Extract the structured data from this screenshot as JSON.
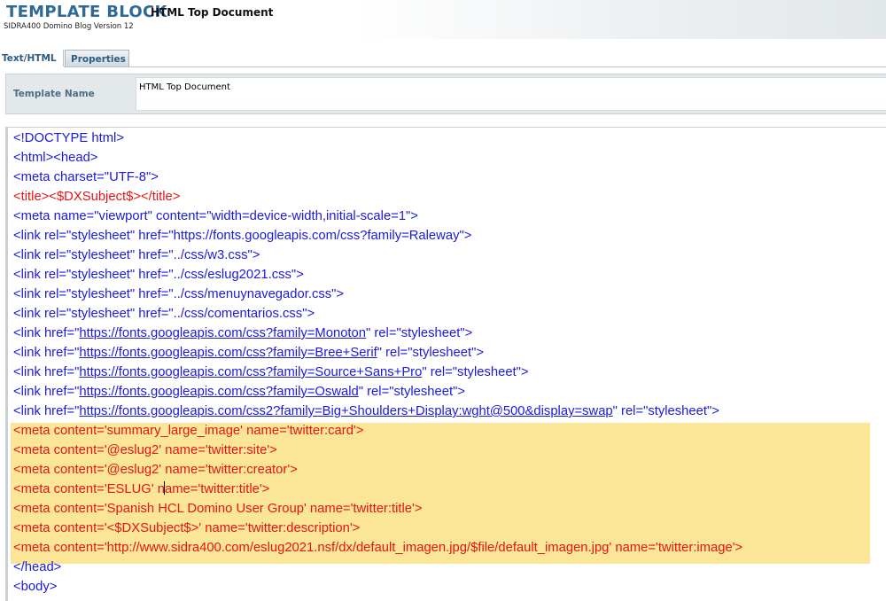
{
  "header": {
    "title": "TEMPLATE BLOCK",
    "subtitle": "HTML Top Document",
    "app_version": "SIDRA400 Domino Blog Version 12"
  },
  "tabs": [
    {
      "label": "Text/HTML",
      "active": true
    },
    {
      "label": "Properties",
      "active": false
    }
  ],
  "template_name": {
    "label": "Template Name",
    "value": "HTML Top Document"
  },
  "colors": {
    "title_blue": "#2d6a96",
    "code_blue": "#1a1adc",
    "code_red": "#e61414",
    "highlight": "#fbe597"
  },
  "code_lines": [
    {
      "color": "blue",
      "parts": [
        {
          "t": "<!DOCTYPE html>"
        }
      ]
    },
    {
      "color": "blue",
      "parts": [
        {
          "t": "<html><head>"
        }
      ]
    },
    {
      "color": "blue",
      "parts": [
        {
          "t": "<meta charset=\"UTF-8\">"
        }
      ]
    },
    {
      "color": "red",
      "parts": [
        {
          "t": "<title><$DXSubject$></title>"
        }
      ]
    },
    {
      "color": "blue",
      "parts": [
        {
          "t": "<meta name=\"viewport\" content=\"width=device-width,initial-scale=1\">"
        }
      ]
    },
    {
      "color": "blue",
      "parts": [
        {
          "t": "<link rel=\"stylesheet\" href=\"https://fonts.googleapis.com/css?family=Raleway\">"
        }
      ]
    },
    {
      "color": "blue",
      "parts": [
        {
          "t": "<link rel=\"stylesheet\" href=\"../css/w3.css\">"
        }
      ]
    },
    {
      "color": "blue",
      "parts": [
        {
          "t": "<link rel=\"stylesheet\" href=\"../css/eslug2021.css\">"
        }
      ]
    },
    {
      "color": "blue",
      "parts": [
        {
          "t": "<link rel=\"stylesheet\" href=\"../css/menuynavegador.css\">"
        }
      ]
    },
    {
      "color": "blue",
      "parts": [
        {
          "t": "<link rel=\"stylesheet\" href=\"../css/comentarios.css\">"
        }
      ]
    },
    {
      "color": "blue",
      "parts": [
        {
          "t": "<link href=\""
        },
        {
          "t": "https://fonts.googleapis.com/css?family=Monoton",
          "link": true
        },
        {
          "t": "\" rel=\"stylesheet\">"
        }
      ]
    },
    {
      "color": "blue",
      "parts": [
        {
          "t": "<link href=\""
        },
        {
          "t": "https://fonts.googleapis.com/css?family=Bree+Serif",
          "link": true
        },
        {
          "t": "\" rel=\"stylesheet\">"
        }
      ]
    },
    {
      "color": "blue",
      "parts": [
        {
          "t": "<link href=\""
        },
        {
          "t": "https://fonts.googleapis.com/css?family=Source+Sans+Pro",
          "link": true
        },
        {
          "t": "\" rel=\"stylesheet\">"
        }
      ]
    },
    {
      "color": "blue",
      "parts": [
        {
          "t": "<link href=\""
        },
        {
          "t": "https://fonts.googleapis.com/css?family=Oswald",
          "link": true
        },
        {
          "t": "\" rel=\"stylesheet\">"
        }
      ]
    },
    {
      "color": "blue",
      "parts": [
        {
          "t": "<link href=\""
        },
        {
          "t": "https://fonts.googleapis.com/css2?family=Big+Shoulders+Display:wght@500&display=swap",
          "link": true
        },
        {
          "t": "\" rel=\"stylesheet\">"
        }
      ]
    },
    {
      "color": "red",
      "parts": [
        {
          "t": "<meta content='summary_large_image' name='twitter:card'>"
        }
      ]
    },
    {
      "color": "red",
      "parts": [
        {
          "t": "<meta content='@eslug2' name='twitter:site'>"
        }
      ]
    },
    {
      "color": "red",
      "parts": [
        {
          "t": "<meta content='@eslug2' name='twitter:creator'>"
        }
      ]
    },
    {
      "color": "red",
      "parts": [
        {
          "t": "<meta content='ESLUG' n"
        },
        {
          "cursor": true
        },
        {
          "t": "ame='twitter:title'>"
        }
      ]
    },
    {
      "color": "red",
      "parts": [
        {
          "t": "<meta content='Spanish HCL Domino User Group' name='twitter:title'>"
        }
      ]
    },
    {
      "color": "red",
      "parts": [
        {
          "t": "<meta content='<$DXSubject$>' name='twitter:description'>"
        }
      ]
    },
    {
      "color": "red",
      "parts": [
        {
          "t": "<meta content='http://www.sidra400.com/eslug2021.nsf/dx/default_imagen.jpg/$file/default_imagen.jpg' name='twitter:image'>"
        }
      ]
    },
    {
      "color": "blue",
      "parts": [
        {
          "t": "</head>"
        }
      ]
    },
    {
      "color": "blue",
      "parts": [
        {
          "t": "<body>"
        }
      ]
    }
  ]
}
